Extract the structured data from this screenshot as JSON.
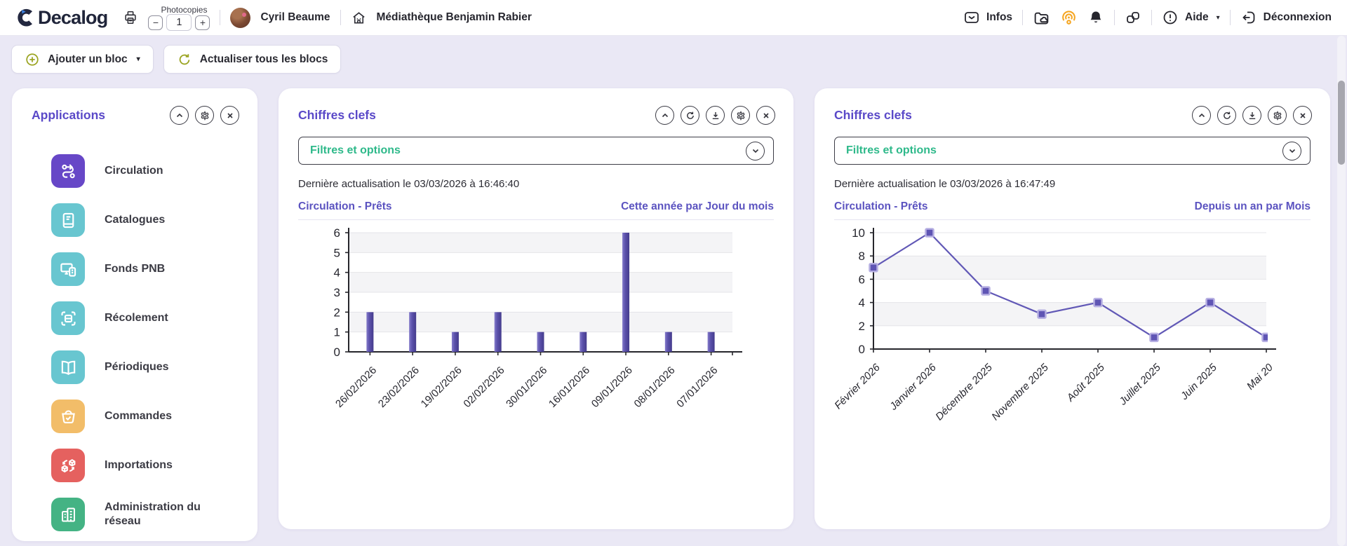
{
  "header": {
    "logo_text": "Decalog",
    "photocopies": {
      "label": "Photocopies",
      "minus": "−",
      "plus": "+",
      "value": "1"
    },
    "user_name": "Cyril Beaume",
    "library_name": "Médiathèque Benjamin Rabier",
    "infos_label": "Infos",
    "aide_label": "Aide",
    "aide_caret": "▾",
    "deconnexion_label": "Déconnexion"
  },
  "toolbar": {
    "add_block_label": "Ajouter un bloc",
    "add_block_caret": "▾",
    "refresh_all_label": "Actualiser tous les blocs"
  },
  "sidebar": {
    "title": "Applications",
    "items": [
      {
        "label": "Circulation",
        "color": "#6747c7",
        "icon": "route-icon"
      },
      {
        "label": "Catalogues",
        "color": "#68c6d0",
        "icon": "book-icon"
      },
      {
        "label": "Fonds PNB",
        "color": "#68c6d0",
        "icon": "devices-icon"
      },
      {
        "label": "Récolement",
        "color": "#68c6d0",
        "icon": "scan-icon"
      },
      {
        "label": "Périodiques",
        "color": "#68c6d0",
        "icon": "open-book-icon"
      },
      {
        "label": "Commandes",
        "color": "#f2bd69",
        "icon": "basket-icon"
      },
      {
        "label": "Importations",
        "color": "#e5615f",
        "icon": "cubes-icon"
      },
      {
        "label": "Administration du réseau",
        "color": "#44b384",
        "icon": "buildings-icon"
      }
    ]
  },
  "panels": [
    {
      "title": "Chiffres clefs",
      "filters_label": "Filtres et options",
      "last_update": "Dernière actualisation le 03/03/2026 à 16:46:40",
      "link_left": "Circulation - Prêts",
      "link_right": "Cette année par Jour du mois"
    },
    {
      "title": "Chiffres clefs",
      "filters_label": "Filtres et options",
      "last_update": "Dernière actualisation le 03/03/2026 à 16:47:49",
      "link_left": "Circulation - Prêts",
      "link_right": "Depuis un an par Mois"
    }
  ],
  "chart_data": [
    {
      "type": "bar",
      "title": "Circulation - Prêts",
      "subtitle": "Cette année par Jour du mois",
      "categories": [
        "26/02/2026",
        "23/02/2026",
        "19/02/2026",
        "02/02/2026",
        "30/01/2026",
        "16/01/2026",
        "09/01/2026",
        "08/01/2026",
        "07/01/2026"
      ],
      "values": [
        2,
        2,
        1,
        2,
        1,
        1,
        6,
        1,
        1
      ],
      "xlabel": "",
      "ylabel": "",
      "ylim": [
        0,
        6
      ],
      "ytick_step": 1,
      "grid": true,
      "legend": "none",
      "colors": {
        "bar_gradient": [
          "#857CCB",
          "#5C52AC",
          "#443B8C"
        ]
      }
    },
    {
      "type": "line",
      "title": "Circulation - Prêts",
      "subtitle": "Depuis un an par Mois",
      "categories": [
        "Février 2026",
        "Janvier 2026",
        "Décembre 2025",
        "Novembre 2025",
        "Août 2025",
        "Juillet 2025",
        "Juin 2025",
        "Mai 20"
      ],
      "values": [
        7,
        10,
        5,
        3,
        4,
        1,
        4,
        1
      ],
      "xlabel": "",
      "ylabel": "",
      "ylim": [
        0,
        10
      ],
      "ytick_step": 2,
      "grid": true,
      "legend": "none",
      "marker": "square",
      "colors": {
        "line": "#6158B6",
        "marker_fill": "#5F55B4",
        "marker_stroke": "#B6AFE2"
      }
    }
  ],
  "chart_style": {
    "stripe": "#f4f4f6",
    "gridline": "#e4e4e8",
    "axis": "#26262c",
    "tick_label": "#26262e",
    "accent_purple": "#5a49c8",
    "accent_green": "#2eb98a",
    "olive_icon": "#9ba421",
    "beacon_orange": "#f5a623"
  }
}
